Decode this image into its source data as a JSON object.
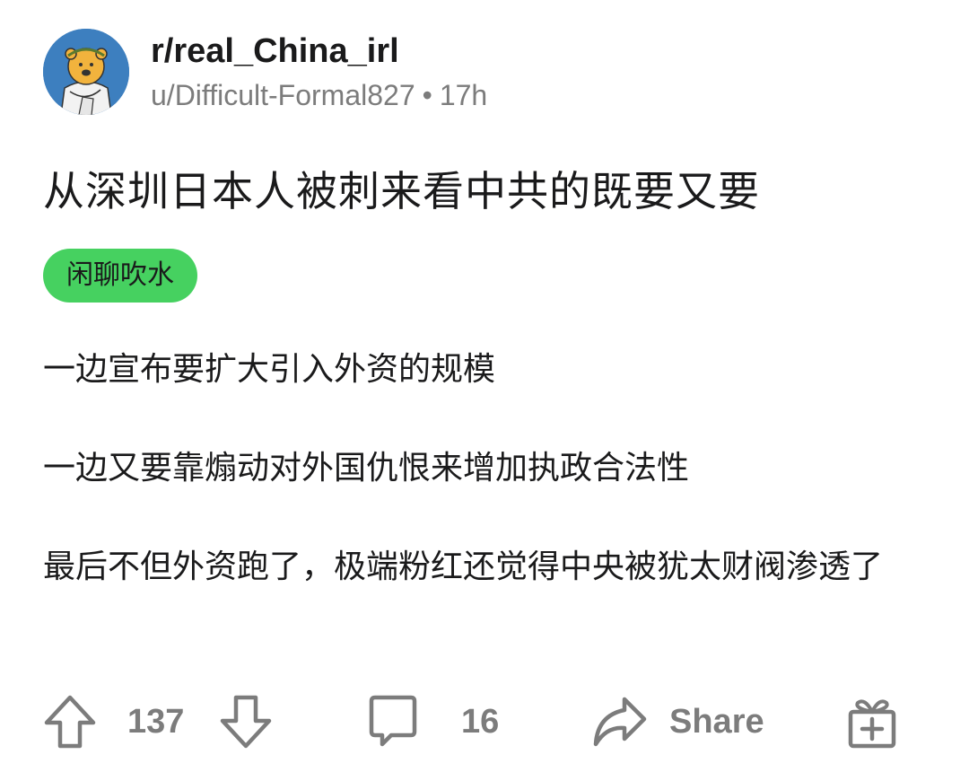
{
  "post": {
    "subreddit": "r/real_China_irl",
    "author": "u/Difficult-Formal827",
    "separator": "•",
    "age": "17h",
    "title": "从深圳日本人被刺来看中共的既要又要",
    "flair": "闲聊吹水",
    "flair_color": "#46d160",
    "body": [
      "一边宣布要扩大引入外资的规模",
      "一边又要靠煽动对外国仇恨来增加执政合法性",
      "最后不但外资跑了，极端粉红还觉得中央被犹太财阀渗透了"
    ]
  },
  "actions": {
    "upvote_icon": "upvote-arrow-icon",
    "score": "137",
    "downvote_icon": "downvote-arrow-icon",
    "comment_icon": "comment-bubble-icon",
    "comments": "16",
    "share_icon": "share-arrow-icon",
    "share_label": "Share",
    "award_icon": "gift-award-icon"
  },
  "colors": {
    "text_primary": "#1a1a1b",
    "text_secondary": "#7c7c7c",
    "avatar_bg": "#3d7fbf"
  }
}
